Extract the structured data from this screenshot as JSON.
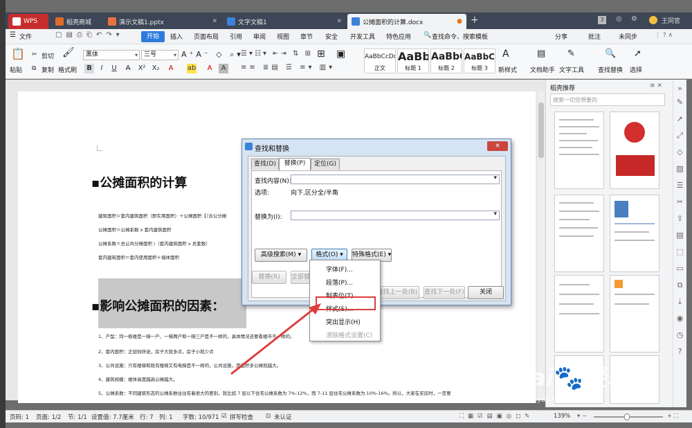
{
  "tabs": [
    {
      "label": "WPS"
    },
    {
      "label": "稻壳商城"
    },
    {
      "label": "演示文稿1.pptx"
    },
    {
      "label": "文字文稿1"
    },
    {
      "label": "公摊面积的计算.docx"
    }
  ],
  "titlebar_right": {
    "count": "3",
    "user": "王同官"
  },
  "menu": {
    "file": "文件",
    "start": "开始",
    "items": [
      "插入",
      "页面布局",
      "引用",
      "审阅",
      "视图",
      "章节",
      "安全",
      "开发工具",
      "特色应用"
    ],
    "search": "查找命令、搜索模板",
    "share": "分享",
    "comment": "批注",
    "sync": "未同步"
  },
  "ribbon": {
    "paste": "粘贴",
    "cut": "剪切",
    "copy": "复制",
    "format_painter": "格式刷",
    "font": "黑体",
    "size": "三号",
    "styles": [
      {
        "sample": "AaBbCcDd",
        "label": "正文"
      },
      {
        "sample": "AaBb",
        "label": "标题 1"
      },
      {
        "sample": "AaBbC",
        "label": "标题 2"
      },
      {
        "sample": "AaBbC",
        "label": "标题 3"
      }
    ],
    "new_style": "新样式",
    "doc_assist": "文档助手",
    "text_tools": "文字工具",
    "find_replace": "查找替换",
    "select": "选择"
  },
  "document": {
    "heading1": "公摊面积的计算",
    "lines1": [
      "建筑面积＝套内建筑面积（即实用面积）＋公摊面积【（含公分摊",
      "公摊面积＝公摊系数 x 套内建筑面积",
      "公摊系数＝总公共分摊面积 /（套内建筑面积 x 总套数）",
      "套内建筑面积＝套内使用面积＋墙体面积"
    ],
    "heading2": "影响公摊面积的因素：",
    "lines2": [
      "1、户型：同一栋楼是一梯一户、一梯两户和一梯三户是不一样的，具体情况还要看楼市不一样的。",
      "2、套内面积：正如你所说，房子大就多点，房子小就少点",
      "3、公共设施：只有楼梯和既有楼梯又有电梯是不一样的，公共设施，是面积多公摊就越大。",
      "4、建筑规模：楼体高度越高公摊越大。",
      "5、公摊系数：不同建筑形态的公摊系数往往有着很大的差别，就比如 7 层以下住宅公摊系数为 7%-12%，而 7-11 层住宅公摊系数为 10%-16%。所以，大家在买房时，一定要"
    ]
  },
  "panel": {
    "title": "稻壳推荐",
    "search_placeholder": "搜索一切您想要的"
  },
  "dialog": {
    "title": "查找和替换",
    "tabs": [
      "查找(D)",
      "替换(P)",
      "定位(G)"
    ],
    "find_label": "查找内容(N):",
    "find_value": "",
    "options_label": "选项:",
    "options_value": "向下,区分全/半角",
    "replace_label": "替换为(I):",
    "replace_value": "",
    "adv_search": "高级搜索(M)",
    "format": "格式(O)",
    "special": "特殊格式(E)",
    "replace_btn": "替换(R)",
    "replace_all_btn": "全部替换(A)",
    "find_prev": "查找上一处(B)",
    "find_next": "查找下一处(F)",
    "close": "关闭"
  },
  "format_menu": [
    "字体(F)...",
    "段落(P)...",
    "制表位(T)...",
    "样式(S)...",
    "突出显示(H)",
    "清除格式设置(C)"
  ],
  "status": {
    "page_no": "页码: 1",
    "pages": "页面: 1/2",
    "section": "节: 1/1",
    "setting": "设置值: 7.7厘米",
    "row": "行: 7",
    "col": "列: 1",
    "words": "字数: 10/971",
    "spell": "拼写检查",
    "auth": "未认证",
    "zoom": "139%"
  },
  "watermark": "Bai 经验",
  "watermark_url": "jingyan.baidu.com",
  "colors": {
    "accent": "#2e7bdd",
    "red_highlight": "#e03c3c",
    "tab_bg": "#3d4656"
  }
}
